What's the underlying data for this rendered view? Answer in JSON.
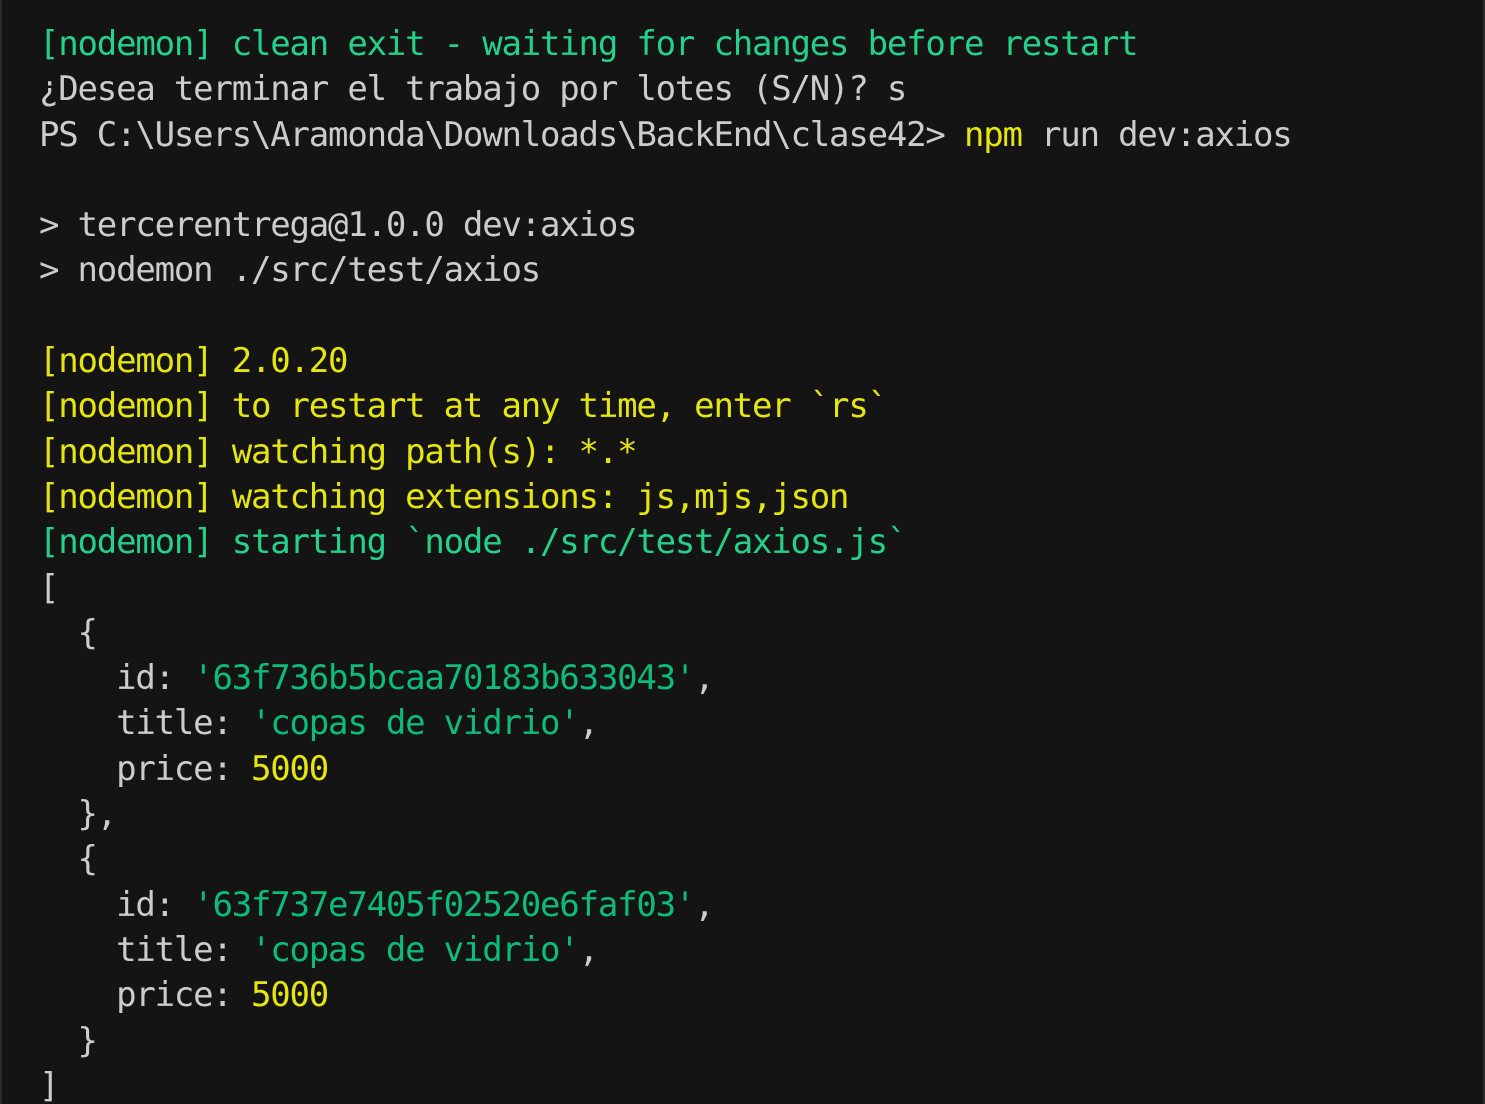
{
  "terminal": {
    "lines": [
      {
        "segments": [
          {
            "text": "[nodemon] clean exit - waiting for changes before restart",
            "color": "green"
          }
        ]
      },
      {
        "segments": [
          {
            "text": "¿Desea terminar el trabajo por lotes (S/N)? s",
            "color": "default"
          }
        ]
      },
      {
        "segments": [
          {
            "text": "PS C:\\Users\\Aramonda\\Downloads\\BackEnd\\clase42> ",
            "color": "default"
          },
          {
            "text": "npm",
            "color": "yellow"
          },
          {
            "text": " run dev:axios",
            "color": "default"
          }
        ]
      },
      {
        "segments": [
          {
            "text": "",
            "color": "default"
          }
        ]
      },
      {
        "segments": [
          {
            "text": "> tercerentrega@1.0.0 dev:axios",
            "color": "default"
          }
        ]
      },
      {
        "segments": [
          {
            "text": "> nodemon ./src/test/axios",
            "color": "default"
          }
        ]
      },
      {
        "segments": [
          {
            "text": "",
            "color": "default"
          }
        ]
      },
      {
        "segments": [
          {
            "text": "[nodemon] 2.0.20",
            "color": "yellow"
          }
        ]
      },
      {
        "segments": [
          {
            "text": "[nodemon] to restart at any time, enter `rs`",
            "color": "yellow"
          }
        ]
      },
      {
        "segments": [
          {
            "text": "[nodemon] watching path(s): *.*",
            "color": "yellow"
          }
        ]
      },
      {
        "segments": [
          {
            "text": "[nodemon] watching extensions: js,mjs,json",
            "color": "yellow"
          }
        ]
      },
      {
        "segments": [
          {
            "text": "[nodemon] starting `node ./src/test/axios.js`",
            "color": "green"
          }
        ]
      },
      {
        "segments": [
          {
            "text": "[",
            "color": "default"
          }
        ]
      },
      {
        "segments": [
          {
            "text": "  {",
            "color": "default"
          }
        ]
      },
      {
        "segments": [
          {
            "text": "    id: ",
            "color": "default"
          },
          {
            "text": "'63f736b5bcaa70183b633043'",
            "color": "string"
          },
          {
            "text": ",",
            "color": "default"
          }
        ]
      },
      {
        "segments": [
          {
            "text": "    title: ",
            "color": "default"
          },
          {
            "text": "'copas de vidrio'",
            "color": "string"
          },
          {
            "text": ",",
            "color": "default"
          }
        ]
      },
      {
        "segments": [
          {
            "text": "    price: ",
            "color": "default"
          },
          {
            "text": "5000",
            "color": "number"
          }
        ]
      },
      {
        "segments": [
          {
            "text": "  },",
            "color": "default"
          }
        ]
      },
      {
        "segments": [
          {
            "text": "  {",
            "color": "default"
          }
        ]
      },
      {
        "segments": [
          {
            "text": "    id: ",
            "color": "default"
          },
          {
            "text": "'63f737e7405f02520e6faf03'",
            "color": "string"
          },
          {
            "text": ",",
            "color": "default"
          }
        ]
      },
      {
        "segments": [
          {
            "text": "    title: ",
            "color": "default"
          },
          {
            "text": "'copas de vidrio'",
            "color": "string"
          },
          {
            "text": ",",
            "color": "default"
          }
        ]
      },
      {
        "segments": [
          {
            "text": "    price: ",
            "color": "default"
          },
          {
            "text": "5000",
            "color": "number"
          }
        ]
      },
      {
        "segments": [
          {
            "text": "  }",
            "color": "default"
          }
        ]
      },
      {
        "segments": [
          {
            "text": "]",
            "color": "default"
          }
        ]
      }
    ]
  },
  "colors": {
    "background": "#141414",
    "default": "#cccccc",
    "green": "#23d18b",
    "yellow": "#e5e510",
    "string": "#0dbc79",
    "number": "#e5e510"
  }
}
